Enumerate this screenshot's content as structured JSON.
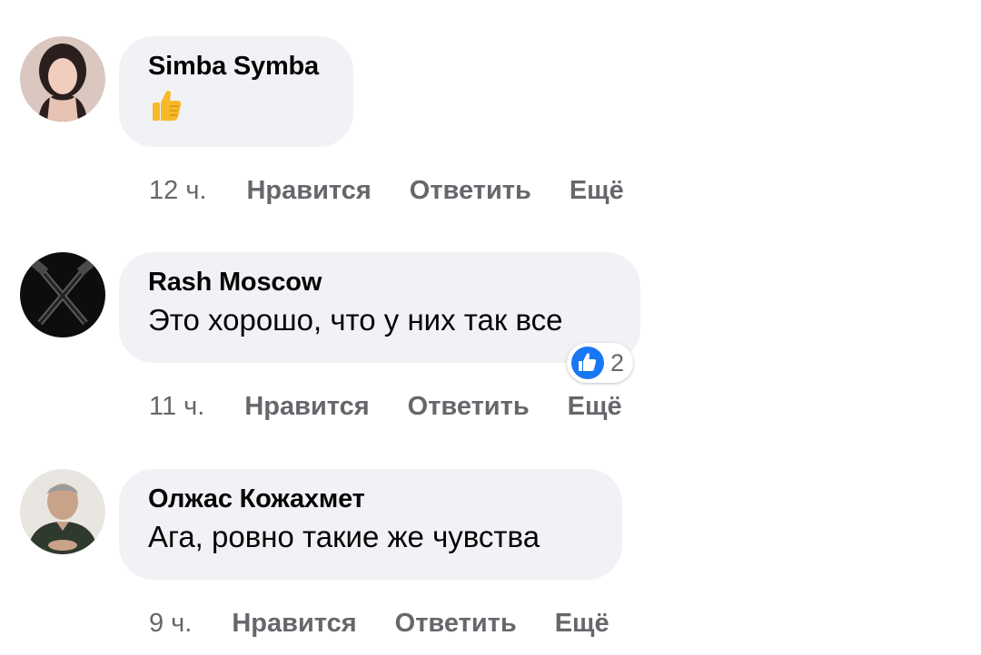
{
  "comments": [
    {
      "author": "Simba Symba",
      "text": "",
      "emoji": "thumbs-up-emoji",
      "time": "12 ч.",
      "like_label": "Нравится",
      "reply_label": "Ответить",
      "more_label": "Ещё"
    },
    {
      "author": "Rash Moscow",
      "text": "Это хорошо, что у них так все",
      "time": "11 ч.",
      "like_label": "Нравится",
      "reply_label": "Ответить",
      "more_label": "Ещё",
      "reaction": {
        "icon": "like-reaction-icon",
        "count": "2"
      }
    },
    {
      "author": "Олжас Кожахмет",
      "text": "Ага, ровно такие же чувства",
      "time": "9 ч.",
      "like_label": "Нравится",
      "reply_label": "Ответить",
      "more_label": "Ещё"
    }
  ],
  "colors": {
    "bubble": "#f0f2f5",
    "meta_text": "#65676b",
    "like_blue": "#1877f2",
    "emoji_yellow": "#f7b928"
  }
}
